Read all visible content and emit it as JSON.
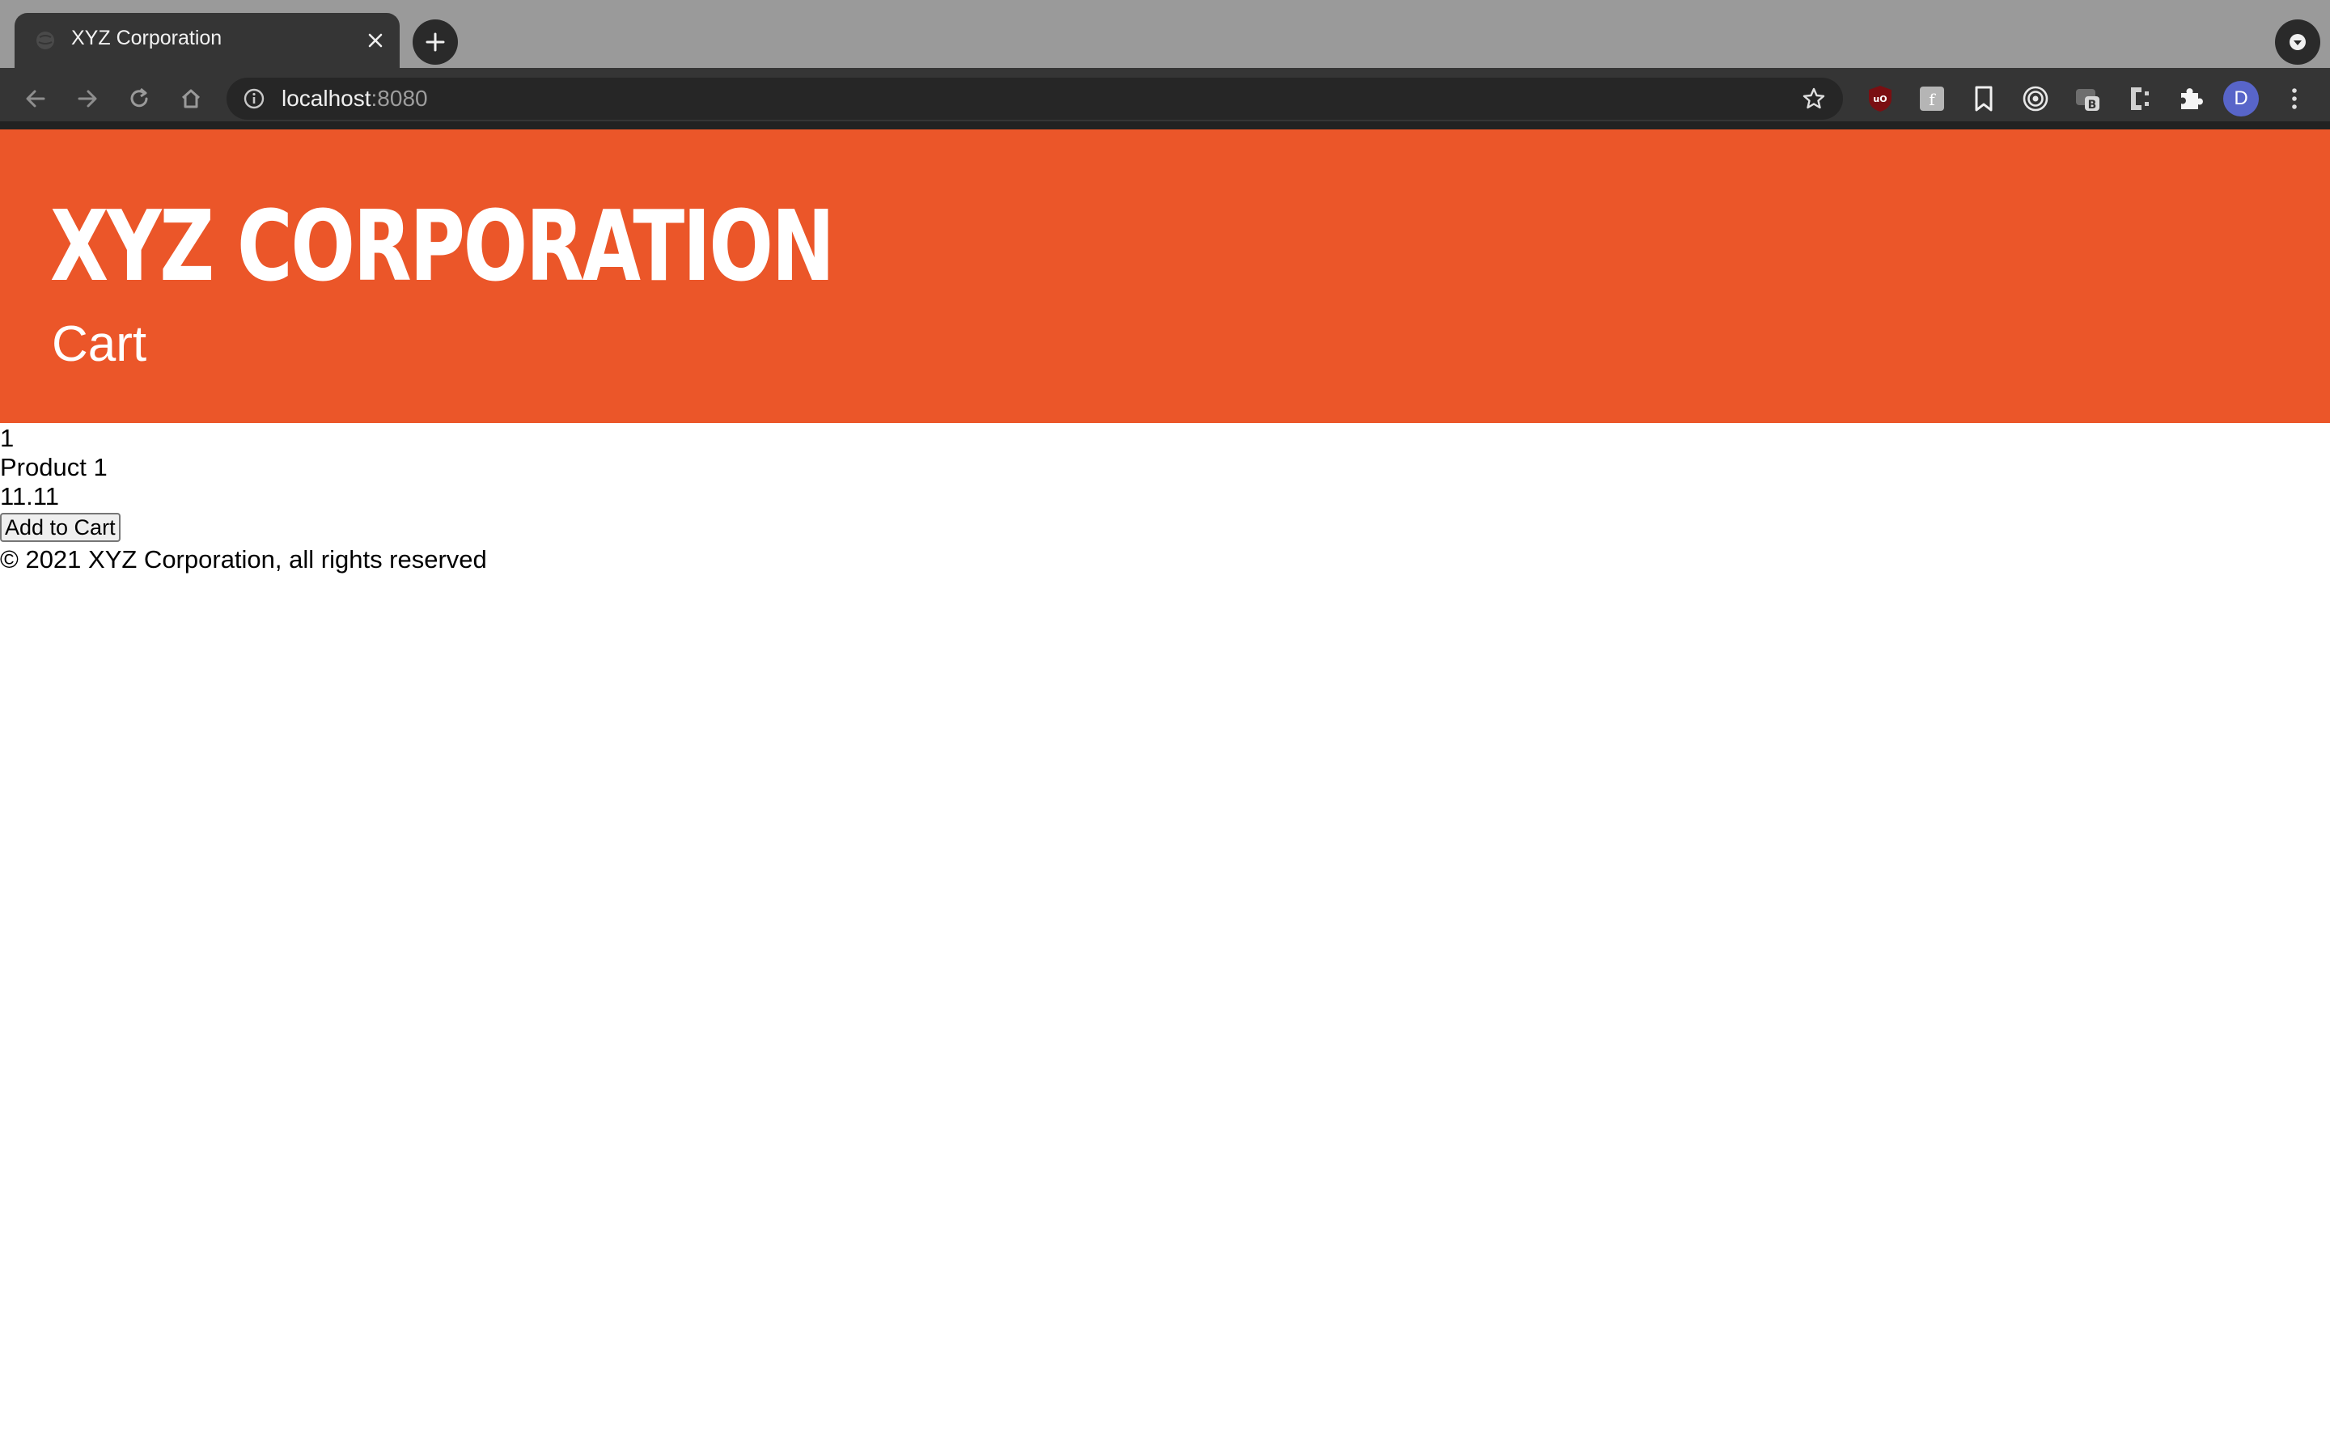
{
  "browser": {
    "tab_title": "XYZ Corporation",
    "url_host": "localhost",
    "url_port": ":8080",
    "profile_initial": "D",
    "icons": {
      "back": "back-arrow-icon",
      "forward": "forward-arrow-icon",
      "reload": "reload-icon",
      "home": "home-icon",
      "info": "info-icon",
      "bookmark_star": "star-icon",
      "extensions": [
        "ublock-icon",
        "extension-f-icon",
        "bookmark-icon",
        "target-icon",
        "extension-b-icon",
        "extension-c-icon",
        "puzzle-icon"
      ],
      "menu": "more-vertical-icon"
    }
  },
  "header": {
    "brand": "XYZ CORPORATION",
    "page_title": "Cart",
    "background_color": "#eb5629"
  },
  "cart": {
    "items": [
      {
        "id": "1",
        "name": "Product 1",
        "price": "11.11",
        "button_label": "Add to Cart"
      }
    ]
  },
  "footer": {
    "text": "© 2021 XYZ Corporation, all rights reserved"
  }
}
